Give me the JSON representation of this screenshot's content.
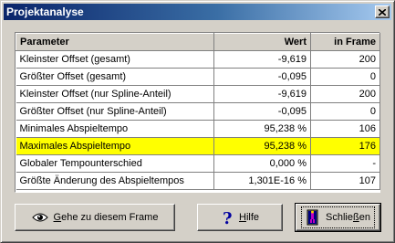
{
  "window": {
    "title": "Projektanalyse"
  },
  "table": {
    "headers": {
      "param": "Parameter",
      "wert": "Wert",
      "frame": "in Frame"
    },
    "rows": [
      {
        "param": "Kleinster Offset (gesamt)",
        "wert": "-9,619",
        "frame": "200",
        "highlight": false
      },
      {
        "param": "Größter Offset (gesamt)",
        "wert": "-0,095",
        "frame": "0",
        "highlight": false
      },
      {
        "param": "Kleinster Offset (nur Spline-Anteil)",
        "wert": "-9,619",
        "frame": "200",
        "highlight": false
      },
      {
        "param": "Größter Offset (nur Spline-Anteil)",
        "wert": "-0,095",
        "frame": "0",
        "highlight": false
      },
      {
        "param": "Minimales Abspieltempo",
        "wert": "95,238 %",
        "frame": "106",
        "highlight": false
      },
      {
        "param": "Maximales Abspieltempo",
        "wert": "95,238 %",
        "frame": "176",
        "highlight": true
      },
      {
        "param": "Globaler Tempounterschied",
        "wert": "0,000 %",
        "frame": "-",
        "highlight": false
      },
      {
        "param": "Größte Änderung des Abspieltempos",
        "wert": "1,301E-16 %",
        "frame": "107",
        "highlight": false
      }
    ],
    "highlight_color": "#ffff00"
  },
  "buttons": {
    "goto": {
      "prefix": "",
      "accel": "G",
      "rest": "ehe zu diesem Frame",
      "icon": "eye-icon"
    },
    "help": {
      "prefix": "",
      "accel": "H",
      "rest": "ilfe",
      "icon": "question-mark-icon"
    },
    "close": {
      "prefix": "Schlie",
      "accel": "ß",
      "rest": "en",
      "icon": "exit-door-icon"
    }
  },
  "colors": {
    "titlebar_start": "#0a246a",
    "titlebar_end": "#a6caf0",
    "face": "#d4d0c8"
  }
}
